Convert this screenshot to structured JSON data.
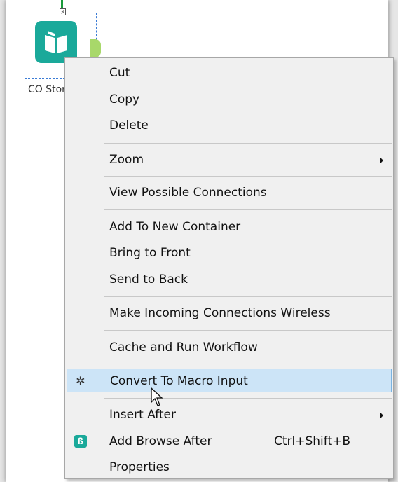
{
  "tool": {
    "label": "CO Store",
    "anchor_glyph": "⚡"
  },
  "context_menu": {
    "items": [
      {
        "label": "Cut"
      },
      {
        "label": "Copy"
      },
      {
        "label": "Delete"
      },
      {
        "label": "Zoom",
        "submenu": true
      },
      {
        "label": "View Possible Connections"
      },
      {
        "label": "Add To New Container"
      },
      {
        "label": "Bring to Front"
      },
      {
        "label": "Send to Back"
      },
      {
        "label": "Make Incoming Connections Wireless"
      },
      {
        "label": "Cache and Run Workflow"
      },
      {
        "label": "Convert To Macro Input",
        "icon": "gear-icon",
        "highlighted": true
      },
      {
        "label": "Insert After",
        "submenu": true
      },
      {
        "label": "Add Browse After",
        "icon": "binoculars-icon",
        "shortcut": "Ctrl+Shift+B"
      },
      {
        "label": "Properties"
      }
    ]
  },
  "colors": {
    "accent": "#1aa99a",
    "highlight": "#cce4f7",
    "connection": "#1a9a3a",
    "output_anchor": "#a8d86a"
  }
}
